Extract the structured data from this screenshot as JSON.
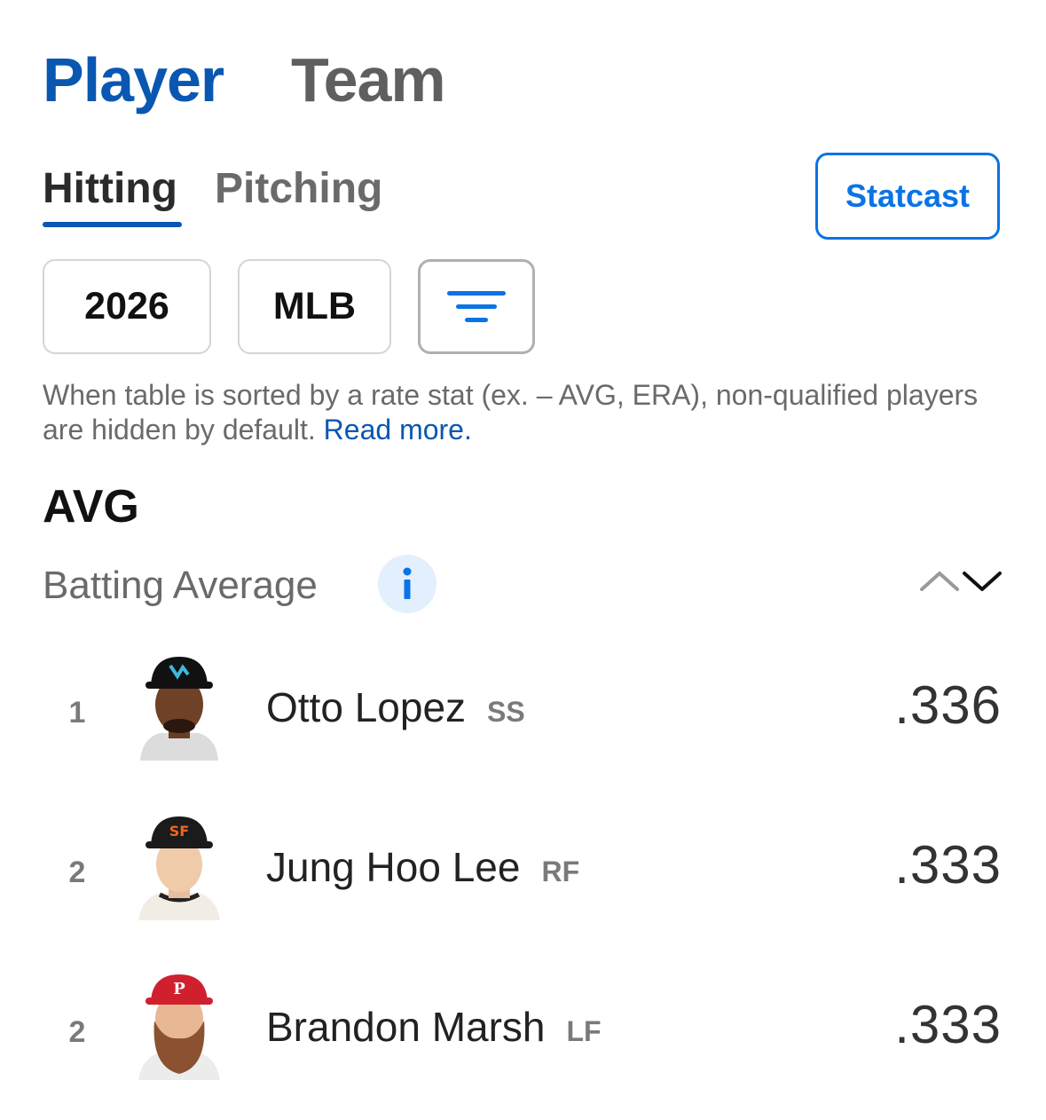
{
  "tabs": {
    "player": "Player",
    "team": "Team"
  },
  "sub_tabs": {
    "hitting": "Hitting",
    "pitching": "Pitching"
  },
  "statcast_label": "Statcast",
  "filters": {
    "season": "2026",
    "league": "MLB",
    "filter_icon": "filter-icon"
  },
  "disclaimer": {
    "text": "When table is sorted by a rate stat (ex. – AVG, ERA), non-qualified players are hidden by default. ",
    "link": "Read more."
  },
  "stat": {
    "abbrev": "AVG",
    "name": "Batting Average",
    "info_icon": "info-icon"
  },
  "colors": {
    "brand_blue": "#0a57b2",
    "accent_blue": "#0a73e6"
  },
  "rows": [
    {
      "rank": "1",
      "name": "Otto Lopez",
      "pos": "SS",
      "value": ".336",
      "team_cap": "marlins-cap",
      "cap_color": "#111111"
    },
    {
      "rank": "2",
      "name": "Jung Hoo Lee",
      "pos": "RF",
      "value": ".333",
      "team_cap": "giants-cap",
      "cap_color": "#1b1b1b"
    },
    {
      "rank": "2",
      "name": "Brandon Marsh",
      "pos": "LF",
      "value": ".333",
      "team_cap": "phillies-cap",
      "cap_color": "#d0202e"
    }
  ]
}
